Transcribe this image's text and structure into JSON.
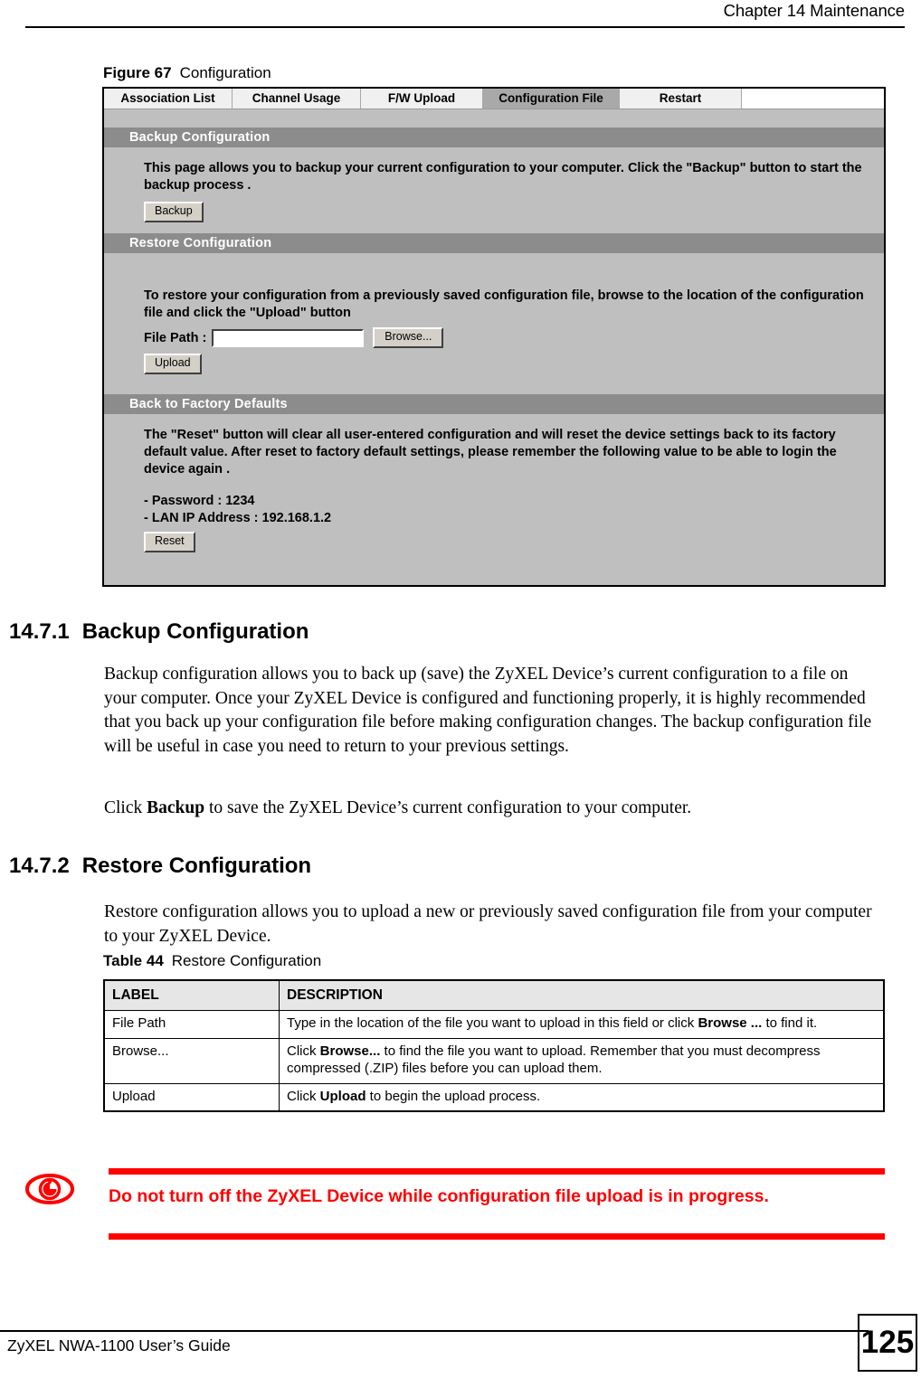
{
  "header": {
    "chapter": "Chapter 14 Maintenance"
  },
  "figure": {
    "number": "Figure 67",
    "title": "Configuration"
  },
  "device_ui": {
    "tabs": [
      {
        "label": "Association List",
        "active": false
      },
      {
        "label": "Channel Usage",
        "active": false
      },
      {
        "label": "F/W Upload",
        "active": false
      },
      {
        "label": "Configuration File",
        "active": true
      },
      {
        "label": "Restart",
        "active": false
      }
    ],
    "backup_section": {
      "title": "Backup Configuration",
      "description": "This page allows you to backup your current configuration to your computer. Click the \"Backup\" button to start the backup process .",
      "button": "Backup"
    },
    "restore_section": {
      "title": "Restore Configuration",
      "description": "To restore your configuration from a previously saved configuration file, browse to the location of the configuration file and click the \"Upload\" button",
      "file_path_label": "File Path :",
      "file_path_value": "",
      "browse_button": "Browse...",
      "upload_button": "Upload"
    },
    "defaults_section": {
      "title": "Back to Factory Defaults",
      "description": "The \"Reset\" button will clear all user-entered configuration and will reset the device settings back to its factory default value. After reset to factory default settings, please remember the following value to be able to login the device again .",
      "password_line": "- Password : 1234",
      "lan_ip_line": "- LAN IP Address : 192.168.1.2",
      "reset_button": "Reset"
    },
    "colors": {
      "page_background": "#bfbfbf",
      "section_bar": "#8c8c8c",
      "active_tab": "#a9a9a9",
      "inactive_tab": "#f0f0f0"
    }
  },
  "sections": [
    {
      "number": "14.7.1",
      "title": "Backup Configuration",
      "paragraphs": [
        "Backup configuration allows you to back up (save) the ZyXEL Device’s current configuration to a file on your computer. Once your ZyXEL Device is configured and functioning properly, it is highly recommended that you back up your configuration file before making configuration changes. The backup configuration file will be useful in case you need to return to your previous settings."
      ],
      "click_line_pre": "Click ",
      "click_line_bold": "Backup",
      "click_line_post": " to save the ZyXEL Device’s current configuration to your computer."
    },
    {
      "number": "14.7.2",
      "title": "Restore Configuration",
      "paragraphs": [
        "Restore configuration allows you to upload a new or previously saved configuration file from your computer to your ZyXEL Device."
      ]
    }
  ],
  "table": {
    "caption_number": "Table 44",
    "caption_title": "Restore Configuration",
    "headers": [
      "LABEL",
      "DESCRIPTION"
    ],
    "rows": [
      {
        "label": "File Path",
        "desc_pre": "Type in the location of the file you want to upload in this field or click ",
        "desc_bold": "Browse ...",
        "desc_post": " to find it."
      },
      {
        "label": "Browse...",
        "desc_pre": "Click ",
        "desc_bold": "Browse...",
        "desc_post": " to find the file you want to upload. Remember that you must decompress compressed (.ZIP) files before you can upload them."
      },
      {
        "label": "Upload",
        "desc_pre": "Click ",
        "desc_bold": "Upload",
        "desc_post": " to begin the upload process."
      }
    ]
  },
  "note": {
    "icon": "eye-warning-icon",
    "text": "Do not turn off the ZyXEL Device while configuration file upload is in progress.",
    "color": "#ff0000"
  },
  "footer": {
    "guide": "ZyXEL NWA-1100 User’s Guide",
    "page_number": "125"
  }
}
